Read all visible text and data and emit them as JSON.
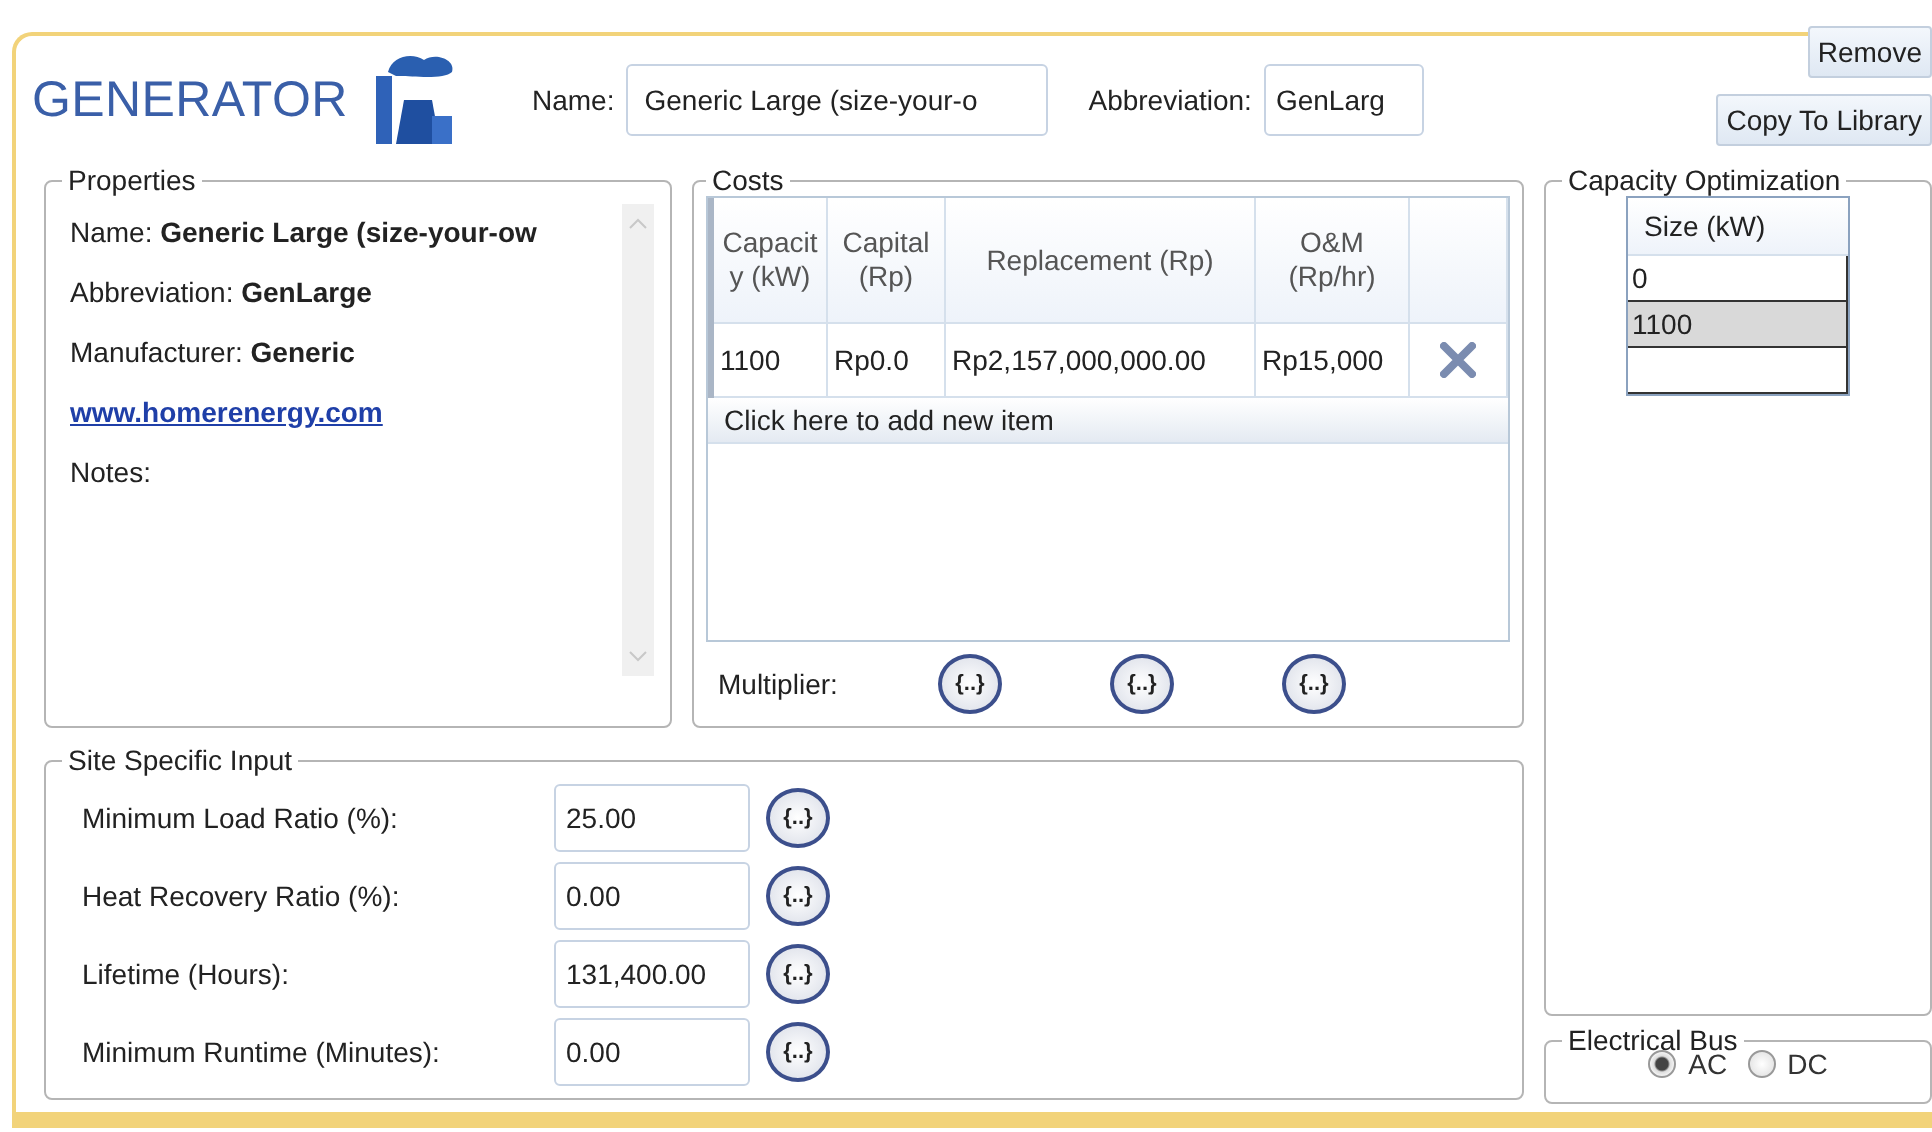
{
  "header": {
    "title": "GENERATOR",
    "name_label": "Name:",
    "name_value": "Generic Large (size-your-o",
    "abbreviation_label": "Abbreviation:",
    "abbreviation_value": "GenLarg",
    "buttons": [
      "Remove",
      "Copy To Library"
    ]
  },
  "properties": {
    "title": "Properties",
    "lines": [
      {
        "kind": "text",
        "text": "Name: **Generic Large (size-your-ow**"
      },
      {
        "kind": "text",
        "text": "Abbreviation: **GenLarge**"
      },
      {
        "kind": "text",
        "text": "Manufacturer: **Generic**"
      },
      {
        "kind": "link",
        "text": "www.homerenergy.com"
      },
      {
        "kind": "text",
        "text": "Notes:"
      }
    ]
  },
  "costs": {
    "title": "Costs",
    "columns": [
      "Capacity (kW)",
      "Capital (Rp)",
      "Replacement (Rp)",
      "O&M (Rp/hr)"
    ],
    "rows": [
      {
        "cells": [
          "1100",
          "Rp0.0",
          "Rp2,157,000,000.00",
          "Rp15,000"
        ]
      }
    ],
    "add_item": "Click here to add new item",
    "multiplier_label": "Multiplier:",
    "multiplier_buttons": [
      "{..}",
      "{..}",
      "{..}"
    ]
  },
  "site_input": {
    "title": "Site Specific Input",
    "fields": [
      {
        "label": "Minimum Load Ratio (%):",
        "value": "25.00",
        "button": "{..}"
      },
      {
        "label": "Heat Recovery Ratio (%):",
        "value": "0.00",
        "button": "{..}"
      },
      {
        "label": "Lifetime (Hours):",
        "value": "131,400.00",
        "button": "{..}"
      },
      {
        "label": "Minimum Runtime (Minutes):",
        "value": "0.00",
        "button": "{..}"
      }
    ]
  },
  "capacity_optimization": {
    "title": "Capacity Optimization",
    "column": "Size (kW)",
    "rows": [
      {
        "value": "0",
        "selected": false
      },
      {
        "value": "1100",
        "selected": true
      }
    ],
    "blank_row": true
  },
  "electrical_bus": {
    "title": "Electrical Bus",
    "options": [
      {
        "label": "AC",
        "selected": true
      },
      {
        "label": "DC",
        "selected": false
      }
    ]
  }
}
